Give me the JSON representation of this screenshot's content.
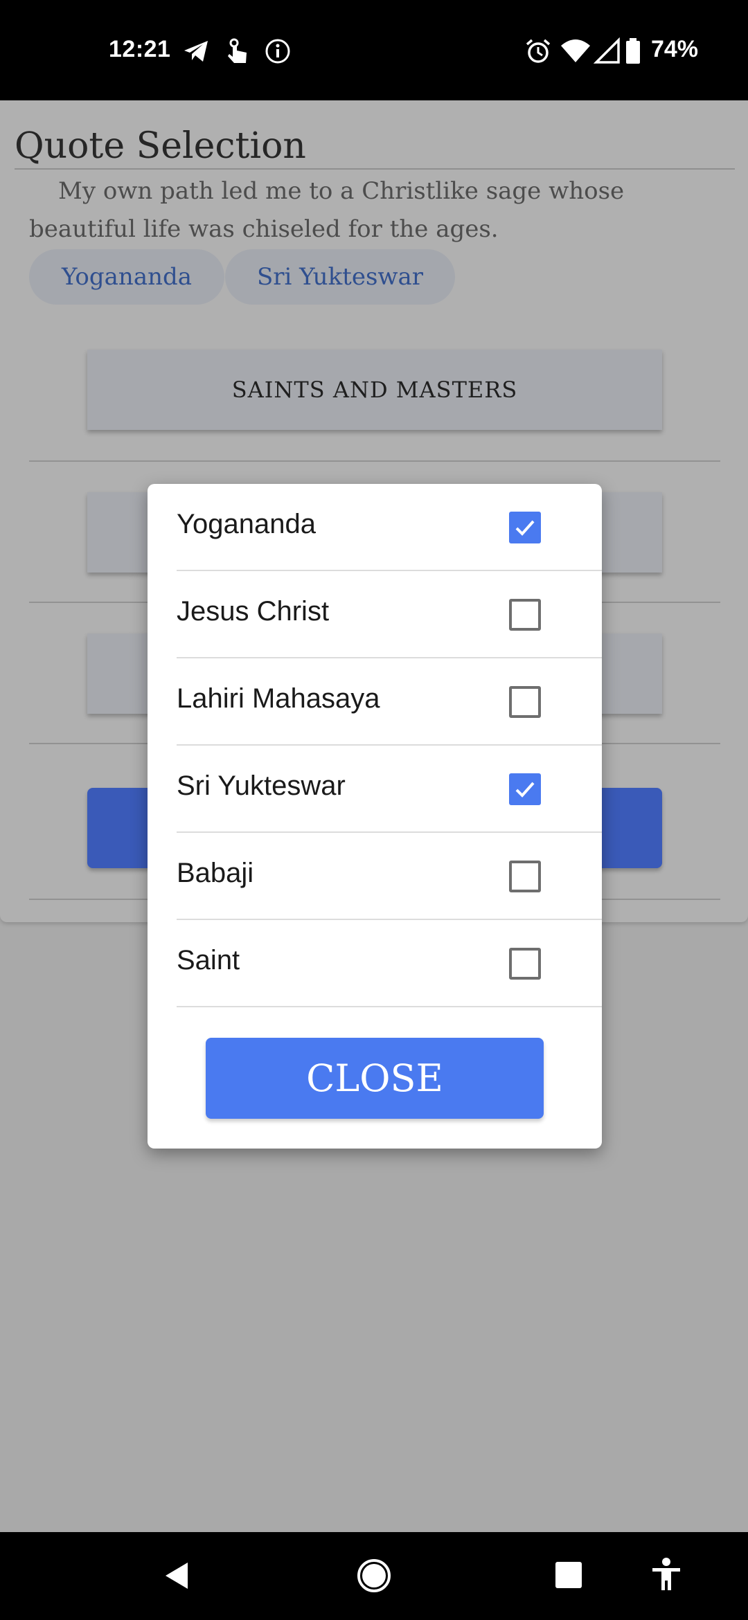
{
  "status_bar": {
    "time": "12:21",
    "battery": "74%",
    "left_icons": [
      "telegram-icon",
      "touch-icon",
      "info-icon"
    ],
    "right_icons": [
      "alarm-icon",
      "wifi-icon",
      "signal-icon",
      "battery-icon"
    ]
  },
  "page": {
    "title": "Quote Selection",
    "quote": "My own path led me to a Christlike sage whose beautiful life was chiseled for the ages.",
    "chips": [
      "Yogananda",
      "Sri Yukteswar"
    ],
    "buttons": {
      "saints_masters": "SAINTS AND MASTERS"
    }
  },
  "dialog": {
    "options": [
      {
        "label": "Yogananda",
        "checked": true
      },
      {
        "label": "Jesus Christ",
        "checked": false
      },
      {
        "label": "Lahiri Mahasaya",
        "checked": false
      },
      {
        "label": "Sri Yukteswar",
        "checked": true
      },
      {
        "label": "Babaji",
        "checked": false
      },
      {
        "label": "Saint",
        "checked": false
      }
    ],
    "close_label": "CLOSE"
  },
  "colors": {
    "accent": "#4a7af0",
    "scrim": "#a9a9a9"
  },
  "nav_bar": {
    "icons": [
      "back-icon",
      "home-icon",
      "recents-icon",
      "accessibility-icon"
    ]
  }
}
